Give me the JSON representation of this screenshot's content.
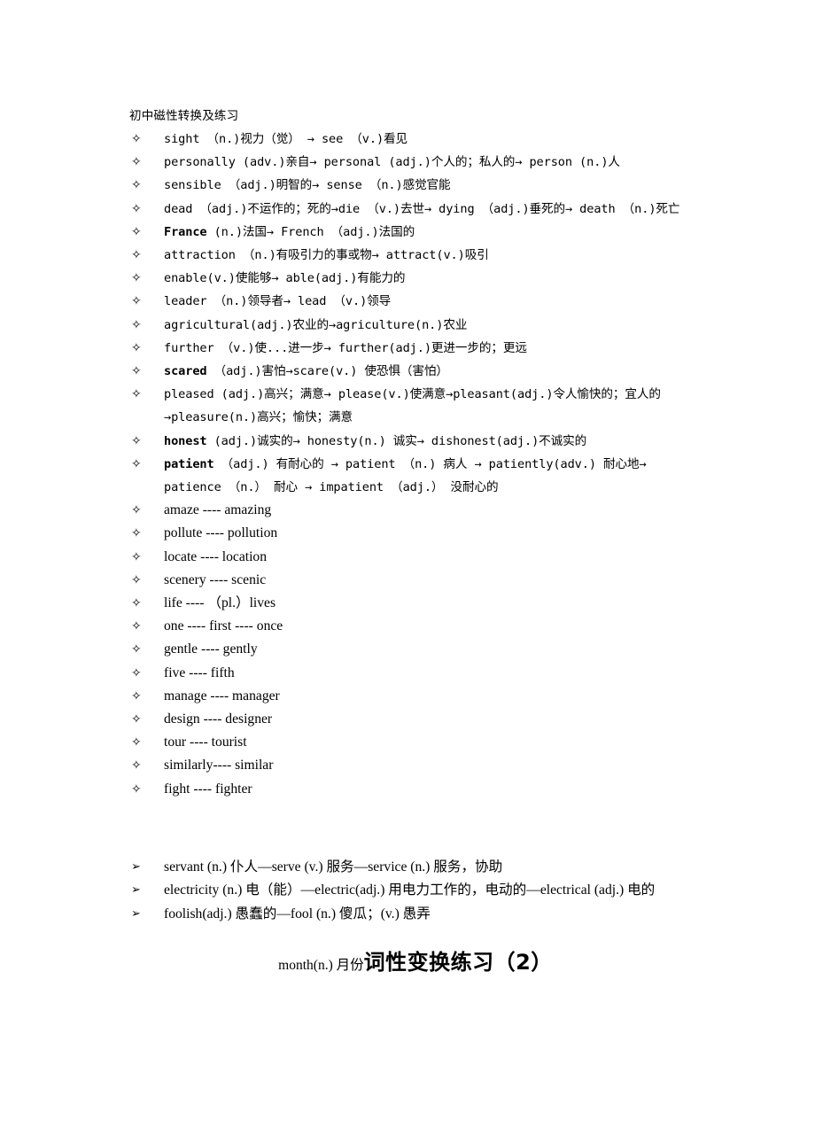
{
  "document": {
    "title": "初中磁性转换及练习",
    "bottom_heading": {
      "lead": "month(n.) 月份",
      "main": "词性变换练习（2）"
    }
  },
  "bullet_symbols": {
    "star": "✧",
    "arrow": "➢"
  },
  "star_list": [
    {
      "id": "sight",
      "style": "mono",
      "bold_head": false,
      "text": "sight （n.)视力（觉） → see （v.)看见"
    },
    {
      "id": "personally",
      "style": "mono",
      "bold_head": false,
      "text": "personally (adv.)亲自→ personal (adj.)个人的；私人的→ person (n.)人"
    },
    {
      "id": "sensible",
      "style": "mono",
      "bold_head": false,
      "text": "sensible （adj.)明智的→ sense （n.)感觉官能"
    },
    {
      "id": "dead",
      "style": "mono",
      "bold_head": false,
      "text": "dead （adj.)不运作的；死的→die （v.)去世→ dying （adj.)垂死的→ death （n.)死亡"
    },
    {
      "id": "france",
      "style": "mono",
      "bold_head": true,
      "head": "France",
      "text": "France (n.)法国→ French （adj.)法国的"
    },
    {
      "id": "attraction",
      "style": "mono",
      "bold_head": false,
      "text": "attraction （n.)有吸引力的事或物→ attract(v.)吸引"
    },
    {
      "id": "enable",
      "style": "mono",
      "bold_head": false,
      "text": "enable(v.)使能够→ able(adj.)有能力的"
    },
    {
      "id": "leader",
      "style": "mono",
      "bold_head": false,
      "text": "leader （n.)领导者→ lead （v.)领导"
    },
    {
      "id": "agricultural",
      "style": "mono",
      "bold_head": false,
      "text": "agricultural(adj.)农业的→agriculture(n.)农业"
    },
    {
      "id": "further",
      "style": "mono",
      "bold_head": false,
      "text": "further （v.)使...进一步→ further(adj.)更进一步的；更远"
    },
    {
      "id": "scared",
      "style": "mono",
      "bold_head": true,
      "head": "scared",
      "text": "scared （adj.)害怕→scare(v.) 使恐惧（害怕）"
    },
    {
      "id": "pleased",
      "style": "mono",
      "bold_head": false,
      "text": "pleased (adj.)高兴；满意→ please(v.)使满意→pleasant(adj.)令人愉快的；宜人的→pleasure(n.)高兴；愉快；满意"
    },
    {
      "id": "honest",
      "style": "mono",
      "bold_head": true,
      "head": "honest",
      "text": "honest (adj.)诚实的→ honesty(n.) 诚实→ dishonest(adj.)不诚实的"
    },
    {
      "id": "patient",
      "style": "mono",
      "bold_head": true,
      "head": "patient",
      "text": "patient （adj.) 有耐心的 → patient （n.) 病人 → patiently(adv.) 耐心地→ patience （n.） 耐心 → impatient （adj.） 没耐心的"
    },
    {
      "id": "amaze",
      "style": "serif",
      "bold_head": false,
      "text": "amaze ---- amazing"
    },
    {
      "id": "pollute",
      "style": "serif",
      "bold_head": false,
      "text": "pollute ---- pollution"
    },
    {
      "id": "locate",
      "style": "serif",
      "bold_head": false,
      "text": "locate ---- location"
    },
    {
      "id": "scenery",
      "style": "serif",
      "bold_head": false,
      "text": "scenery ---- scenic"
    },
    {
      "id": "life",
      "style": "serif",
      "bold_head": false,
      "text": "life ----  （pl.）lives"
    },
    {
      "id": "one",
      "style": "serif",
      "bold_head": false,
      "text": "one ---- first ---- once"
    },
    {
      "id": "gentle",
      "style": "serif",
      "bold_head": false,
      "text": "gentle ---- gently"
    },
    {
      "id": "five",
      "style": "serif",
      "bold_head": false,
      "text": "five ---- fifth"
    },
    {
      "id": "manage",
      "style": "serif",
      "bold_head": false,
      "text": "manage ---- manager"
    },
    {
      "id": "design",
      "style": "serif",
      "bold_head": false,
      "text": "design ---- designer"
    },
    {
      "id": "tour",
      "style": "serif",
      "bold_head": false,
      "text": "tour ---- tourist"
    },
    {
      "id": "similarly",
      "style": "serif",
      "bold_head": false,
      "text": "similarly---- similar"
    },
    {
      "id": "fight",
      "style": "serif",
      "bold_head": false,
      "text": "fight ---- fighter"
    }
  ],
  "arrow_list": [
    {
      "id": "servant",
      "text": "servant (n.) 仆人—serve (v.) 服务—service (n.) 服务，协助"
    },
    {
      "id": "electricity",
      "text": "electricity (n.) 电（能）—electric(adj.) 用电力工作的，电动的—electrical (adj.) 电的"
    },
    {
      "id": "foolish",
      "text": "foolish(adj.) 愚蠢的—fool (n.) 傻瓜；(v.) 愚弄"
    }
  ]
}
